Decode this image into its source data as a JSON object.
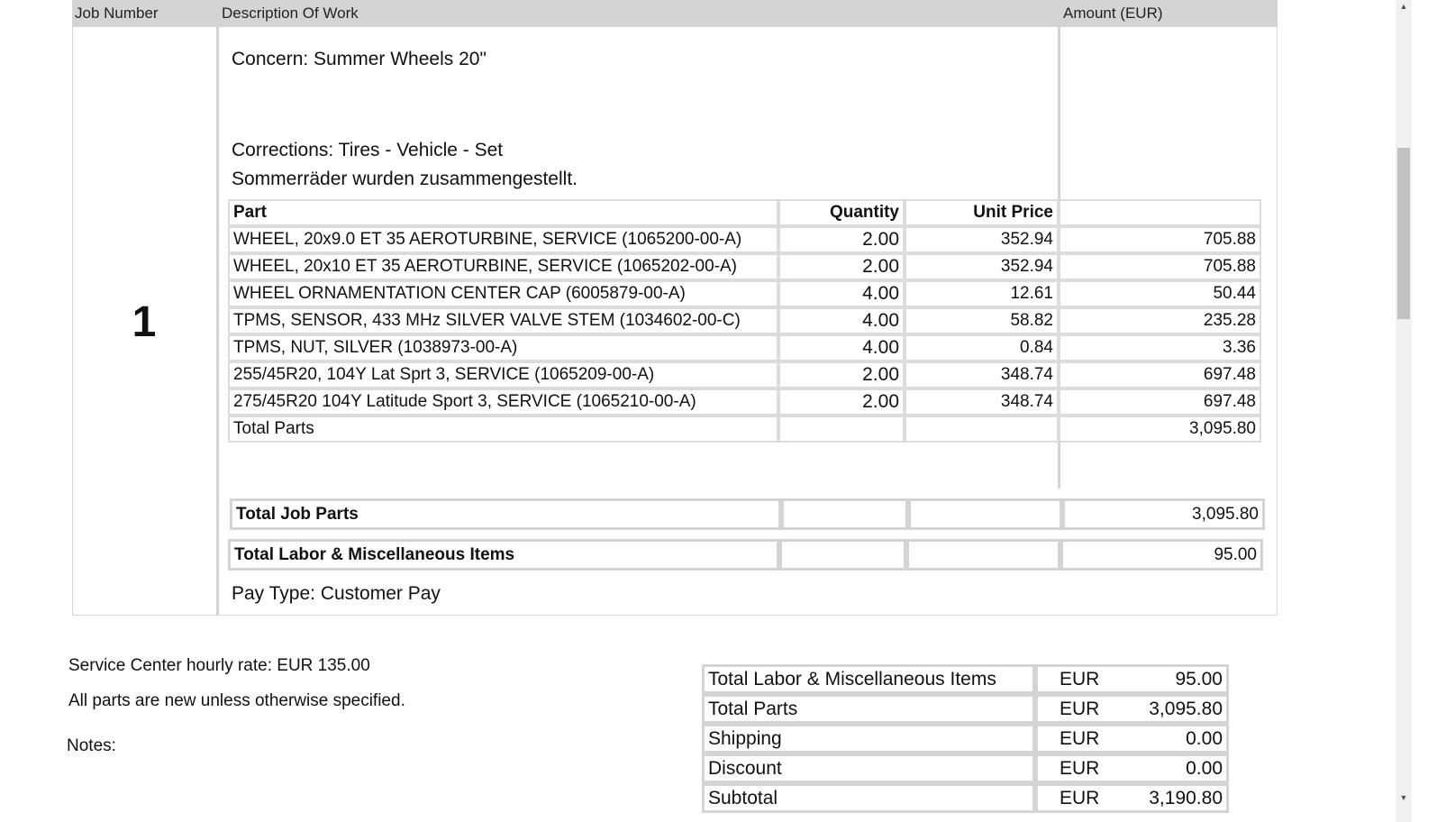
{
  "header": {
    "job_number": "Job Number",
    "description": "Description Of Work",
    "amount": "Amount (EUR)"
  },
  "job": {
    "number": "1",
    "concern": "Concern: Summer Wheels 20\"",
    "corrections": "Corrections: Tires - Vehicle - Set",
    "note": "Sommerräder wurden zusammengestellt.",
    "parts_header": {
      "part": "Part",
      "quantity": "Quantity",
      "unit_price": "Unit Price"
    },
    "parts": [
      {
        "part": "WHEEL, 20x9.0 ET 35 AEROTURBINE, SERVICE (1065200-00-A)",
        "qty": "2.00",
        "unit": "352.94",
        "amount": "705.88"
      },
      {
        "part": "WHEEL, 20x10 ET 35 AEROTURBINE, SERVICE (1065202-00-A)",
        "qty": "2.00",
        "unit": "352.94",
        "amount": "705.88"
      },
      {
        "part": "WHEEL ORNAMENTATION CENTER CAP (6005879-00-A)",
        "qty": "4.00",
        "unit": "12.61",
        "amount": "50.44"
      },
      {
        "part": "TPMS, SENSOR, 433 MHz SILVER VALVE STEM (1034602-00-C)",
        "qty": "4.00",
        "unit": "58.82",
        "amount": "235.28"
      },
      {
        "part": "TPMS, NUT, SILVER (1038973-00-A)",
        "qty": "4.00",
        "unit": "0.84",
        "amount": "3.36"
      },
      {
        "part": "255/45R20, 104Y Lat Sprt 3, SERVICE (1065209-00-A)",
        "qty": "2.00",
        "unit": "348.74",
        "amount": "697.48"
      },
      {
        "part": "275/45R20 104Y Latitude Sport 3, SERVICE (1065210-00-A)",
        "qty": "2.00",
        "unit": "348.74",
        "amount": "697.48"
      }
    ],
    "total_parts_label": "Total Parts",
    "total_parts_value": "3,095.80",
    "total_job_parts_label": "Total Job Parts",
    "total_job_parts_value": "3,095.80",
    "total_labor_label": "Total Labor & Miscellaneous Items",
    "total_labor_value": "95.00",
    "pay_type": "Pay Type: Customer Pay"
  },
  "footer": {
    "hourly_rate": "Service Center hourly rate: EUR 135.00",
    "parts_note": "All parts are new unless otherwise specified.",
    "notes_label": "Notes:"
  },
  "summary": [
    {
      "label": "Total Labor & Miscellaneous Items",
      "currency": "EUR",
      "value": "95.00"
    },
    {
      "label": "Total Parts",
      "currency": "EUR",
      "value": "3,095.80"
    },
    {
      "label": "Shipping",
      "currency": "EUR",
      "value": "0.00"
    },
    {
      "label": "Discount",
      "currency": "EUR",
      "value": "0.00"
    },
    {
      "label": "Subtotal",
      "currency": "EUR",
      "value": "3,190.80"
    }
  ]
}
